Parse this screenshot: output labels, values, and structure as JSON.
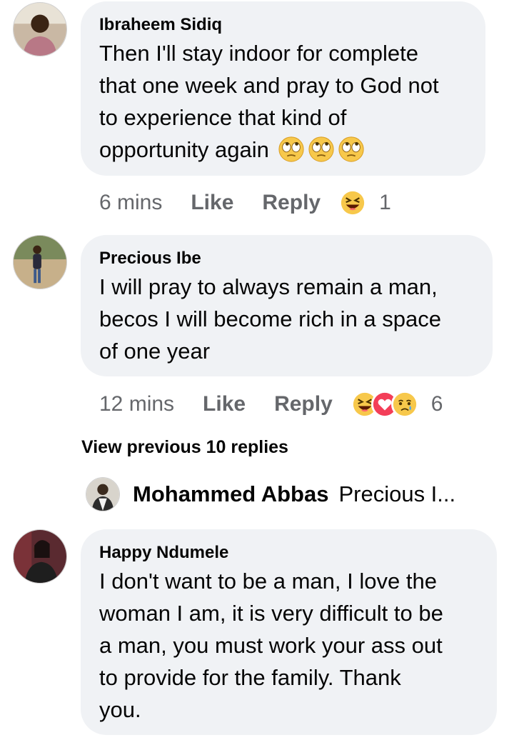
{
  "comments": [
    {
      "author": "Ibraheem Sidiq",
      "lines": [
        "Then I'll stay indoor for complete",
        "that one week and pray to God not",
        "to experience that kind of",
        "opportunity again"
      ],
      "emojis": [
        "face-with-rolling-eyes",
        "face-with-rolling-eyes",
        "face-with-rolling-eyes"
      ],
      "time": "6 mins",
      "like": "Like",
      "reply": "Reply",
      "reaction_icons": [
        "laughing-squint-emoji"
      ],
      "reaction_count": "1"
    },
    {
      "author": "Precious Ibe",
      "lines": [
        "I will pray to always remain a man,",
        "becos I will become rich in a space",
        "of one year"
      ],
      "time": "12 mins",
      "like": "Like",
      "reply": "Reply",
      "reaction_icons": [
        "laughing-squint-emoji",
        "heart-emoji",
        "sad-tear-emoji"
      ],
      "reaction_count": "6"
    },
    {
      "author": "Happy Ndumele",
      "lines": [
        "I don't want to be a man, I love the",
        "woman I am, it is very difficult to be",
        "a man, you must work your ass out",
        "to provide for the family. Thank",
        "you."
      ]
    }
  ],
  "view_previous": "View previous 10 replies",
  "latest_reply": {
    "author": "Mohammed Abbas",
    "preview": "Precious I..."
  },
  "colors": {
    "bubble": "#f0f2f5",
    "meta_text": "#65676b",
    "text": "#050505"
  }
}
